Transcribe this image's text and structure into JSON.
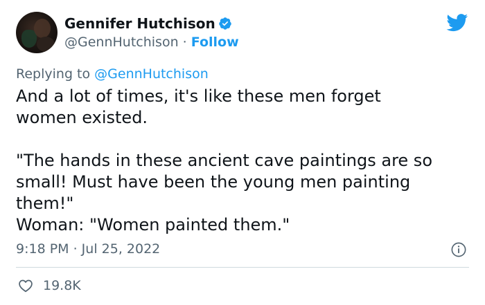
{
  "author": {
    "display_name": "Gennifer Hutchison",
    "handle": "@GennHutchison",
    "separator": " · ",
    "follow_label": "Follow"
  },
  "reply": {
    "prefix": "Replying to ",
    "handle": "@GennHutchison"
  },
  "tweet": {
    "lines": [
      "And a lot of times, it's like these men forget",
      "women existed.",
      "",
      "\"The hands in these ancient cave paintings are so",
      "small! Must have been the young men painting",
      "them!\"",
      "Woman: \"Women painted them.\""
    ],
    "timestamp": "9:18 PM · Jul 25, 2022"
  },
  "engagement": {
    "likes": "19.8K"
  },
  "colors": {
    "accent": "#1d9bf0",
    "text": "#0f1419",
    "secondary": "#536471",
    "divider": "#cfd9de"
  },
  "icons": {
    "verified": "verified-badge-icon",
    "logo": "twitter-bird-icon",
    "info": "info-icon",
    "like": "heart-icon"
  }
}
